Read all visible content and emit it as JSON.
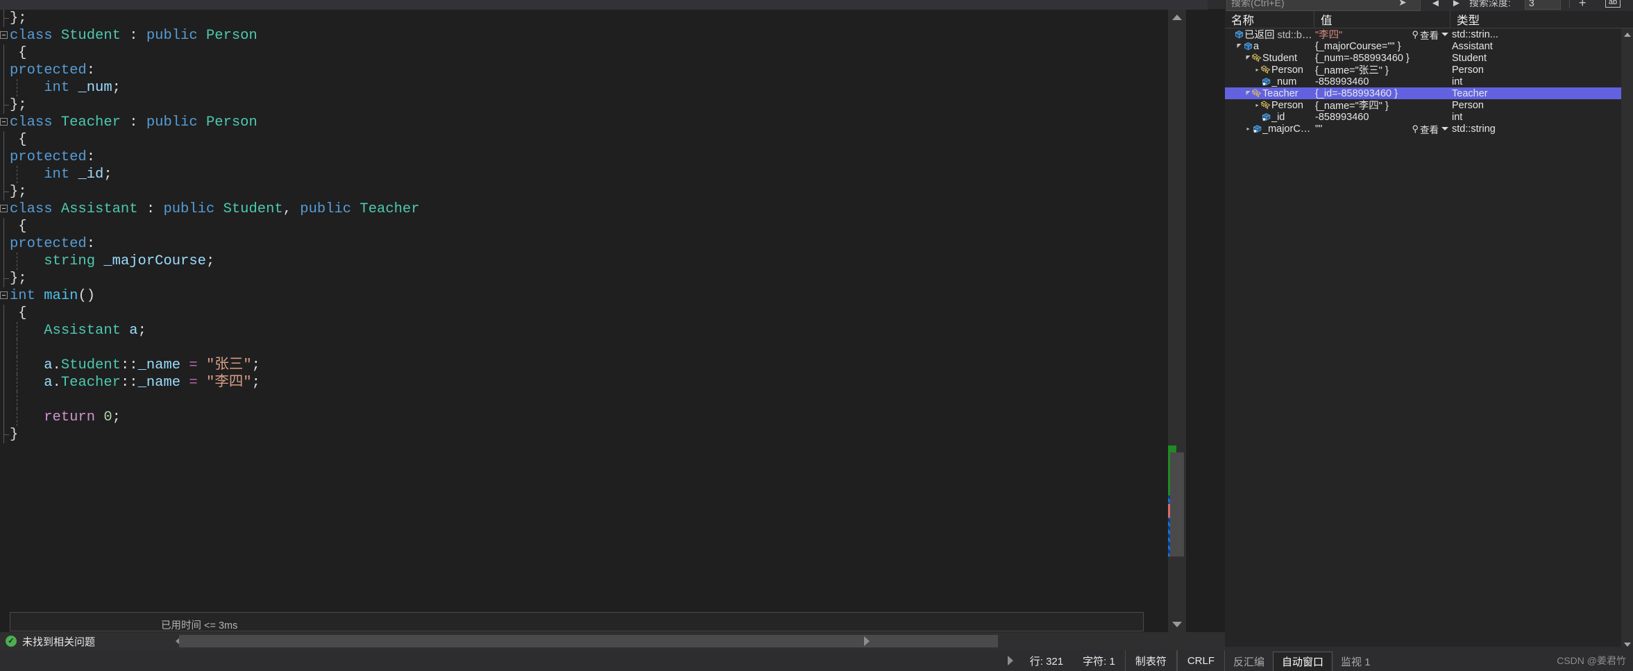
{
  "editor": {
    "lines": [
      {
        "indent": 0,
        "fold": "end",
        "parts": [
          {
            "t": "};",
            "c": "c-punct"
          }
        ]
      },
      {
        "indent": 0,
        "fold": "open",
        "parts": [
          {
            "t": "class ",
            "c": "c-kw"
          },
          {
            "t": "Student",
            "c": "c-type"
          },
          {
            "t": " : ",
            "c": "c-punct"
          },
          {
            "t": "public ",
            "c": "c-kw"
          },
          {
            "t": "Person",
            "c": "c-type"
          }
        ]
      },
      {
        "indent": 0,
        "fold": "bar",
        "parts": [
          {
            "t": " {",
            "c": "c-punct"
          }
        ]
      },
      {
        "indent": 0,
        "fold": "bar",
        "parts": [
          {
            "t": "protected",
            "c": "c-kw"
          },
          {
            "t": ":",
            "c": "c-punct"
          }
        ]
      },
      {
        "indent": 1,
        "fold": "bar",
        "parts": [
          {
            "t": "    ",
            "c": "c-plain"
          },
          {
            "t": "int",
            "c": "c-kw"
          },
          {
            "t": " ",
            "c": "c-plain"
          },
          {
            "t": "_num",
            "c": "c-var"
          },
          {
            "t": ";",
            "c": "c-punct"
          }
        ]
      },
      {
        "indent": 0,
        "fold": "end",
        "parts": [
          {
            "t": "};",
            "c": "c-punct"
          }
        ]
      },
      {
        "indent": 0,
        "fold": "open",
        "parts": [
          {
            "t": "class ",
            "c": "c-kw"
          },
          {
            "t": "Teacher",
            "c": "c-type"
          },
          {
            "t": " : ",
            "c": "c-punct"
          },
          {
            "t": "public ",
            "c": "c-kw"
          },
          {
            "t": "Person",
            "c": "c-type"
          }
        ]
      },
      {
        "indent": 0,
        "fold": "bar",
        "parts": [
          {
            "t": " {",
            "c": "c-punct"
          }
        ]
      },
      {
        "indent": 0,
        "fold": "bar",
        "parts": [
          {
            "t": "protected",
            "c": "c-kw"
          },
          {
            "t": ":",
            "c": "c-punct"
          }
        ]
      },
      {
        "indent": 1,
        "fold": "bar",
        "parts": [
          {
            "t": "    ",
            "c": "c-plain"
          },
          {
            "t": "int",
            "c": "c-kw"
          },
          {
            "t": " ",
            "c": "c-plain"
          },
          {
            "t": "_id",
            "c": "c-var"
          },
          {
            "t": ";",
            "c": "c-punct"
          }
        ]
      },
      {
        "indent": 0,
        "fold": "end",
        "parts": [
          {
            "t": "};",
            "c": "c-punct"
          }
        ]
      },
      {
        "indent": 0,
        "fold": "open",
        "parts": [
          {
            "t": "class ",
            "c": "c-kw"
          },
          {
            "t": "Assistant",
            "c": "c-type"
          },
          {
            "t": " : ",
            "c": "c-punct"
          },
          {
            "t": "public ",
            "c": "c-kw"
          },
          {
            "t": "Student",
            "c": "c-type"
          },
          {
            "t": ", ",
            "c": "c-punct"
          },
          {
            "t": "public ",
            "c": "c-kw"
          },
          {
            "t": "Teacher",
            "c": "c-type"
          }
        ]
      },
      {
        "indent": 0,
        "fold": "bar",
        "parts": [
          {
            "t": " {",
            "c": "c-punct"
          }
        ]
      },
      {
        "indent": 0,
        "fold": "bar",
        "parts": [
          {
            "t": "protected",
            "c": "c-kw"
          },
          {
            "t": ":",
            "c": "c-punct"
          }
        ]
      },
      {
        "indent": 1,
        "fold": "bar",
        "parts": [
          {
            "t": "    ",
            "c": "c-plain"
          },
          {
            "t": "string",
            "c": "c-type"
          },
          {
            "t": " ",
            "c": "c-plain"
          },
          {
            "t": "_majorCourse",
            "c": "c-var"
          },
          {
            "t": ";",
            "c": "c-punct"
          }
        ]
      },
      {
        "indent": 0,
        "fold": "end",
        "parts": [
          {
            "t": "};",
            "c": "c-punct"
          }
        ]
      },
      {
        "indent": 0,
        "fold": "open",
        "parts": [
          {
            "t": "int ",
            "c": "c-kw"
          },
          {
            "t": "main",
            "c": "c-fn"
          },
          {
            "t": "()",
            "c": "c-punct"
          }
        ]
      },
      {
        "indent": 0,
        "fold": "bar",
        "parts": [
          {
            "t": " {",
            "c": "c-punct"
          }
        ]
      },
      {
        "indent": 1,
        "fold": "bar",
        "parts": [
          {
            "t": "    ",
            "c": "c-plain"
          },
          {
            "t": "Assistant",
            "c": "c-type"
          },
          {
            "t": " ",
            "c": "c-plain"
          },
          {
            "t": "a",
            "c": "c-var"
          },
          {
            "t": ";",
            "c": "c-punct"
          }
        ]
      },
      {
        "indent": 1,
        "fold": "bar",
        "parts": []
      },
      {
        "indent": 1,
        "fold": "bar",
        "parts": [
          {
            "t": "    ",
            "c": "c-plain"
          },
          {
            "t": "a",
            "c": "c-var"
          },
          {
            "t": ".",
            "c": "c-punct"
          },
          {
            "t": "Student",
            "c": "c-type"
          },
          {
            "t": "::",
            "c": "c-punct"
          },
          {
            "t": "_name",
            "c": "c-var"
          },
          {
            "t": " ",
            "c": "c-plain"
          },
          {
            "t": "=",
            "c": "c-op"
          },
          {
            "t": " ",
            "c": "c-plain"
          },
          {
            "t": "\"张三\"",
            "c": "c-str"
          },
          {
            "t": ";",
            "c": "c-punct"
          }
        ]
      },
      {
        "indent": 1,
        "fold": "bar",
        "parts": [
          {
            "t": "    ",
            "c": "c-plain"
          },
          {
            "t": "a",
            "c": "c-var"
          },
          {
            "t": ".",
            "c": "c-punct"
          },
          {
            "t": "Teacher",
            "c": "c-type"
          },
          {
            "t": "::",
            "c": "c-punct"
          },
          {
            "t": "_name",
            "c": "c-var"
          },
          {
            "t": " ",
            "c": "c-plain"
          },
          {
            "t": "=",
            "c": "c-op"
          },
          {
            "t": " ",
            "c": "c-plain"
          },
          {
            "t": "\"李四\"",
            "c": "c-str"
          },
          {
            "t": ";",
            "c": "c-punct"
          }
        ]
      },
      {
        "indent": 1,
        "fold": "bar",
        "parts": []
      },
      {
        "indent": 1,
        "fold": "bar",
        "parts": [
          {
            "t": "    ",
            "c": "c-plain"
          },
          {
            "t": "return",
            "c": "c-ret"
          },
          {
            "t": " ",
            "c": "c-plain"
          },
          {
            "t": "0",
            "c": "c-num"
          },
          {
            "t": ";",
            "c": "c-punct"
          }
        ]
      },
      {
        "indent": 0,
        "fold": "endlast",
        "parts": [
          {
            "t": "}",
            "c": "c-punct"
          }
        ]
      }
    ],
    "elapsed_badge": "已用时间 <= 3ms",
    "error_status": "未找到相关问题",
    "statusbar": {
      "line_label": "行: 321",
      "char_label": "字符: 1",
      "indent_mode": "制表符",
      "eol_mode": "CRLF"
    }
  },
  "watch": {
    "toolbar": {
      "search_placeholder": "搜索(Ctrl+E)",
      "search_value": "",
      "prev_label": "◄",
      "next_label": "►",
      "depth_label": "搜索深度:",
      "depth_value": "3",
      "plus_label": "+",
      "ab_label": "ab"
    },
    "columns": {
      "name": "名称",
      "value": "值",
      "type": "类型"
    },
    "rows": [
      {
        "indent": 0,
        "expander": "",
        "icon": "refresh-cube-icon",
        "name": "已返回 std::ba...",
        "name_prefix": "已返回",
        "name_suffix": " std::ba...",
        "value": "\"李四\"",
        "value_kind": "string",
        "view_label": "查看",
        "has_view": true,
        "type": "std::strin...",
        "selected": false
      },
      {
        "indent": 1,
        "expander": "expanded",
        "icon": "cube-icon",
        "name": "a",
        "value": "{_majorCourse=\"\" }",
        "value_kind": "plain",
        "has_view": false,
        "type": "Assistant",
        "selected": false
      },
      {
        "indent": 2,
        "expander": "expanded",
        "icon": "base-class-icon",
        "name": "Student",
        "value": "{_num=-858993460 }",
        "value_kind": "plain",
        "has_view": false,
        "type": "Student",
        "selected": false
      },
      {
        "indent": 3,
        "expander": "collapsed",
        "icon": "base-class-icon",
        "name": "Person",
        "value": "{_name=\"张三\" }",
        "value_kind": "plain",
        "has_view": false,
        "type": "Person",
        "selected": false
      },
      {
        "indent": 3,
        "expander": "",
        "icon": "field-icon",
        "name": "_num",
        "value": "-858993460",
        "value_kind": "plain",
        "has_view": false,
        "type": "int",
        "selected": false
      },
      {
        "indent": 2,
        "expander": "expanded",
        "icon": "base-class-icon",
        "name": "Teacher",
        "value": "{_id=-858993460 }",
        "value_kind": "plain",
        "has_view": false,
        "type": "Teacher",
        "selected": true
      },
      {
        "indent": 3,
        "expander": "collapsed",
        "icon": "base-class-icon",
        "name": "Person",
        "value": "{_name=\"李四\" }",
        "value_kind": "plain",
        "has_view": false,
        "type": "Person",
        "selected": false
      },
      {
        "indent": 3,
        "expander": "",
        "icon": "field-icon",
        "name": "_id",
        "value": "-858993460",
        "value_kind": "plain",
        "has_view": false,
        "type": "int",
        "selected": false
      },
      {
        "indent": 2,
        "expander": "collapsed",
        "icon": "field-icon",
        "name": "_majorCou...",
        "value": "\"\"",
        "value_kind": "plain",
        "view_label": "查看",
        "has_view": true,
        "type": "std::string",
        "selected": false
      }
    ],
    "tabs": [
      {
        "label": "反汇编",
        "active": false
      },
      {
        "label": "自动窗口",
        "active": true
      },
      {
        "label": "监视 1",
        "active": false
      }
    ],
    "watermark": "CSDN @姜君竹"
  },
  "colors": {
    "selection": "#6262e0",
    "keyword": "#569cd6",
    "type": "#4ec9b0",
    "string": "#d69d85",
    "accent_green": "#1f8b24",
    "accent_red": "#d96a6a",
    "accent_blue": "#1f6fd0"
  }
}
